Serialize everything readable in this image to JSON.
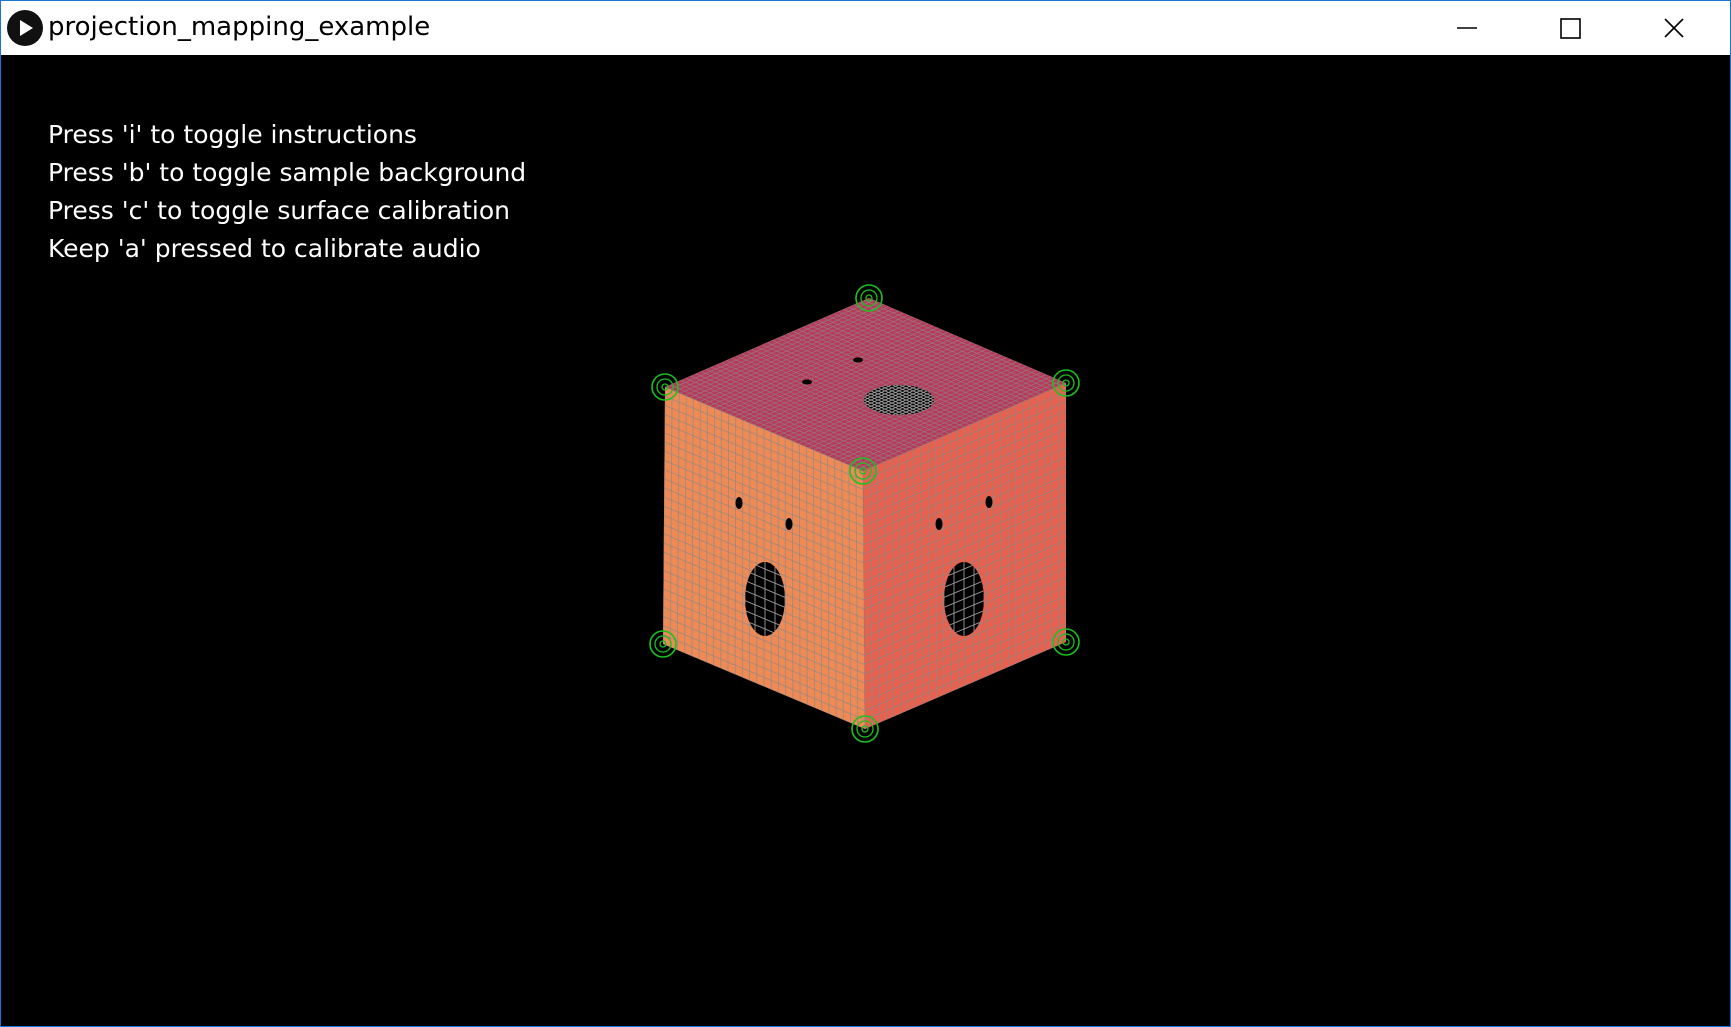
{
  "window": {
    "title": "projection_mapping_example",
    "app_icon": "play-icon",
    "controls": [
      "minimize-icon",
      "maximize-icon",
      "close-icon"
    ]
  },
  "instructions": [
    "Press 'i' to toggle instructions",
    "Press 'b' to toggle sample background",
    "Press 'c' to toggle surface calibration",
    "Keep 'a' pressed to calibrate audio"
  ],
  "colors": {
    "top_face": "#b8395a",
    "left_face": "#ef8a55",
    "right_face": "#e8604e",
    "grid_line": "#8a8a8a",
    "calibration_handle": "#19c21e",
    "title_bar_border": "#1a75d6"
  }
}
